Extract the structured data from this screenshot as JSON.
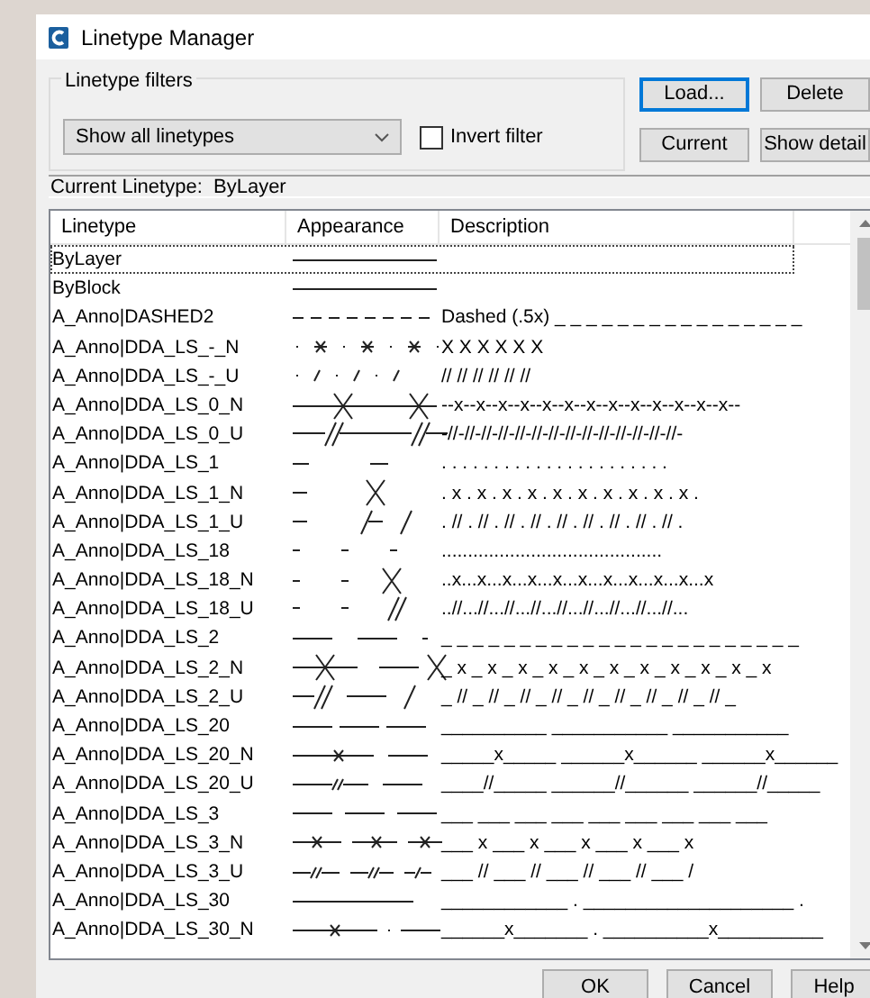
{
  "window": {
    "title": "Linetype Manager"
  },
  "filters": {
    "group_label": "Linetype filters",
    "dropdown": {
      "value": "Show all linetypes"
    },
    "invert_filter": {
      "label": "Invert filter",
      "checked": false
    }
  },
  "side_buttons": [
    {
      "label": "Load...",
      "default": true
    },
    {
      "label": "Delete",
      "default": false
    },
    {
      "label": "Current",
      "default": false
    },
    {
      "label": "Show detail",
      "default": false
    }
  ],
  "current_linetype": "Current Linetype:  ByLayer",
  "table": {
    "columns": [
      "Linetype",
      "Appearance",
      "Description"
    ],
    "rows": [
      {
        "linetype": "ByLayer",
        "focused": true
      },
      {
        "linetype": "ByBlock",
        "focused": false
      },
      {
        "linetype": "A_Anno|DASHED2",
        "description": "Dashed (.5x) _ _ _ _ _ _ _ _ _ _ _ _ _ _ _ _",
        "focused": false
      },
      {
        "linetype": "A_Anno|DDA_LS_-_N",
        "description": "X X X X X X",
        "focused": false
      },
      {
        "linetype": "A_Anno|DDA_LS_-_U",
        "description": "// // // // // //",
        "focused": false
      },
      {
        "linetype": "A_Anno|DDA_LS_0_N",
        "description": "--x--x--x--x--x--x--x--x--x--x--x--x--x--",
        "focused": false
      },
      {
        "linetype": "A_Anno|DDA_LS_0_U",
        "description": "-//-//-//-//-//-//-//-//-//-//-//-//-//-//-",
        "focused": false
      },
      {
        "linetype": "A_Anno|DDA_LS_1",
        "description": ". . . . . . . . . . . . . . . . . . . . . .",
        "focused": false
      },
      {
        "linetype": "A_Anno|DDA_LS_1_N",
        "description": ". x . x . x . x . x . x . x . x . x . x .",
        "focused": false
      },
      {
        "linetype": "A_Anno|DDA_LS_1_U",
        "description": ". // . // . // . // . // . // . // . // . // .",
        "focused": false
      },
      {
        "linetype": "A_Anno|DDA_LS_18",
        "description": "..........................................",
        "focused": false
      },
      {
        "linetype": "A_Anno|DDA_LS_18_N",
        "description": "..x...x...x...x...x...x...x...x...x...x...x",
        "focused": false
      },
      {
        "linetype": "A_Anno|DDA_LS_18_U",
        "description": "..//...//...//...//...//...//...//...//...//...",
        "focused": false
      },
      {
        "linetype": "A_Anno|DDA_LS_2",
        "description": "_ _ _ _ _ _ _ _ _ _ _ _ _ _ _ _ _ _ _ _ _ _ _",
        "focused": false
      },
      {
        "linetype": "A_Anno|DDA_LS_2_N",
        "description": "_ x _ x _ x _ x _ x _ x _ x _ x _ x _ x _ x",
        "focused": false
      },
      {
        "linetype": "A_Anno|DDA_LS_2_U",
        "description": "_ // _ // _ // _ // _ // _ // _ // _ // _ // _",
        "focused": false
      },
      {
        "linetype": "A_Anno|DDA_LS_20",
        "description": "__________  ___________  ___________",
        "focused": false
      },
      {
        "linetype": "A_Anno|DDA_LS_20_N",
        "description": "_____x_____ ______x______ ______x______",
        "focused": false
      },
      {
        "linetype": "A_Anno|DDA_LS_20_U",
        "description": "____//_____ ______//______ ______//_____",
        "focused": false
      },
      {
        "linetype": "A_Anno|DDA_LS_3",
        "description": "___  ___  ___  ___  ___  ___  ___  ___  ___",
        "focused": false
      },
      {
        "linetype": "A_Anno|DDA_LS_3_N",
        "description": "___  x  ___  x  ___  x  ___  x  ___  x",
        "focused": false
      },
      {
        "linetype": "A_Anno|DDA_LS_3_U",
        "description": "___  //  ___  //  ___  //  ___  //  ___  /",
        "focused": false
      },
      {
        "linetype": "A_Anno|DDA_LS_30",
        "description": "____________ . ____________________ .",
        "focused": false
      },
      {
        "linetype": "A_Anno|DDA_LS_30_N",
        "description": "______x_______ . __________x__________",
        "focused": false
      }
    ]
  },
  "bottom_buttons": [
    {
      "label": "OK"
    },
    {
      "label": "Cancel"
    },
    {
      "label": "Help"
    }
  ]
}
